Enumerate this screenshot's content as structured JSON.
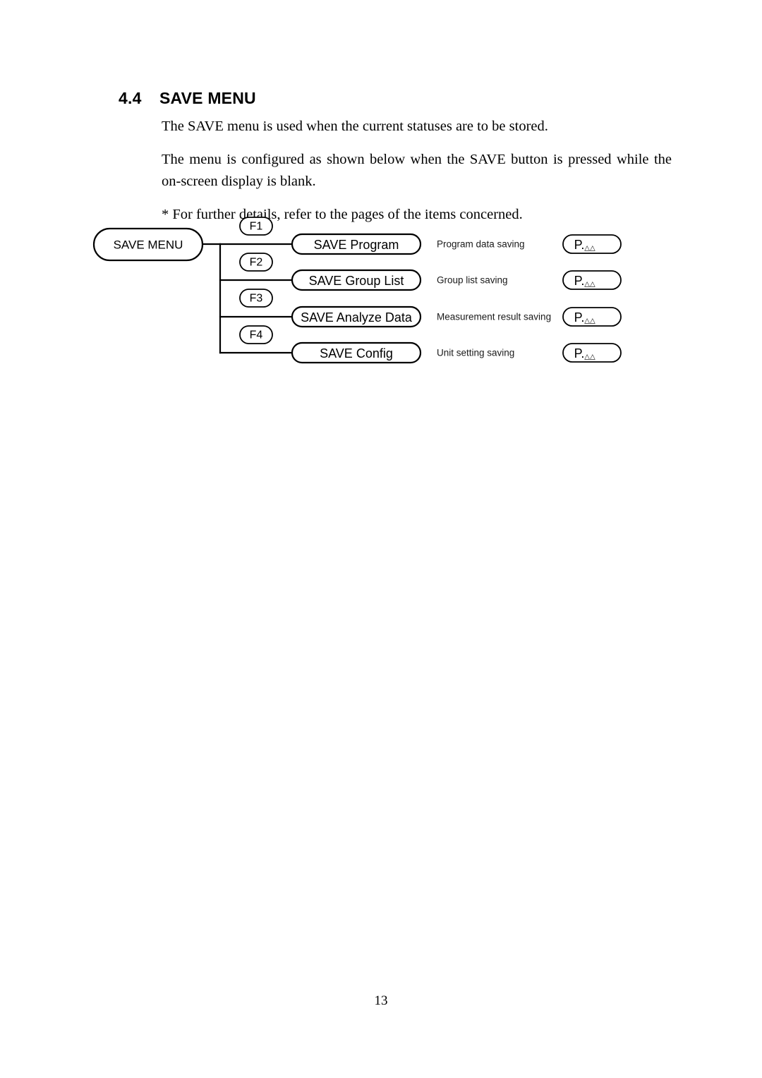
{
  "heading": {
    "section_number": "4.4",
    "title": "SAVE MENU"
  },
  "body": {
    "paragraph_1": "The SAVE menu is used when the current statuses are to be stored.",
    "paragraph_2": "The menu is configured as shown below when the SAVE button is pressed while the on-screen display is blank.",
    "paragraph_3": "* For further details, refer to the pages of the items concerned."
  },
  "diagram": {
    "root_label": "SAVE MENU",
    "rows": [
      {
        "fkey": "F1",
        "menu_label": "SAVE Program",
        "description": "Program data saving",
        "page_ref_prefix": "P.",
        "page_ref_placeholder": "△△"
      },
      {
        "fkey": "F2",
        "menu_label": "SAVE Group List",
        "description": "Group list saving",
        "page_ref_prefix": "P.",
        "page_ref_placeholder": "△△"
      },
      {
        "fkey": "F3",
        "menu_label": "SAVE Analyze Data",
        "description": "Measurement result saving",
        "page_ref_prefix": "P.",
        "page_ref_placeholder": "△△"
      },
      {
        "fkey": "F4",
        "menu_label": "SAVE Config",
        "description": "Unit setting saving",
        "page_ref_prefix": "P.",
        "page_ref_placeholder": "△△"
      }
    ]
  },
  "footer": {
    "page_number": "13"
  },
  "colors": {
    "ink": "#000000",
    "paper": "#ffffff",
    "desc_ink": "#1a1a1a"
  }
}
